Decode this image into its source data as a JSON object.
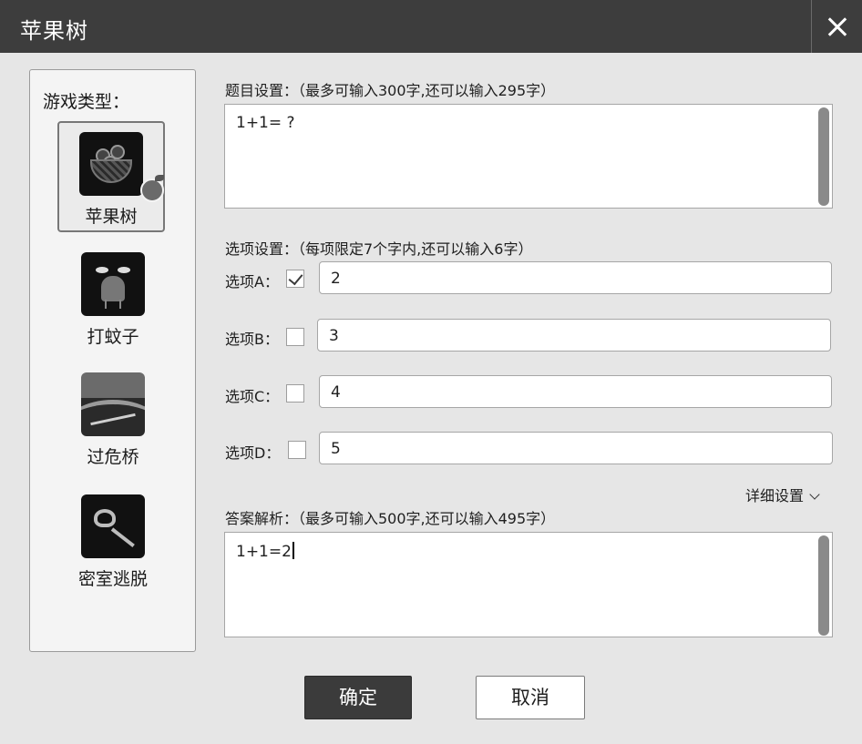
{
  "window": {
    "title": "苹果树"
  },
  "sidebar": {
    "title": "游戏类型：",
    "games": [
      {
        "label": "苹果树",
        "icon": "apple-basket-icon",
        "selected": true
      },
      {
        "label": "打蚊子",
        "icon": "mosquito-icon",
        "selected": false
      },
      {
        "label": "过危桥",
        "icon": "bridge-icon",
        "selected": false
      },
      {
        "label": "密室逃脱",
        "icon": "key-icon",
        "selected": false
      }
    ]
  },
  "question": {
    "label": "题目设置：（最多可输入300字,还可以输入295字）",
    "value": "1+1= ?"
  },
  "options": {
    "label": "选项设置：（每项限定7个字内,还可以输入6字）",
    "items": [
      {
        "label": "选项A：",
        "checked": true,
        "value": "2"
      },
      {
        "label": "选项B：",
        "checked": false,
        "value": "3"
      },
      {
        "label": "选项C：",
        "checked": false,
        "value": "4"
      },
      {
        "label": "选项D：",
        "checked": false,
        "value": "5"
      }
    ]
  },
  "details": {
    "label": "详细设置"
  },
  "analysis": {
    "label": "答案解析：（最多可输入500字,还可以输入495字）",
    "value": "1+1=2"
  },
  "buttons": {
    "ok": "确定",
    "cancel": "取消"
  },
  "colors": {
    "titlebar": "#3d3d3d",
    "primary_button": "#3b3b3b",
    "background": "#e6e6e6"
  }
}
